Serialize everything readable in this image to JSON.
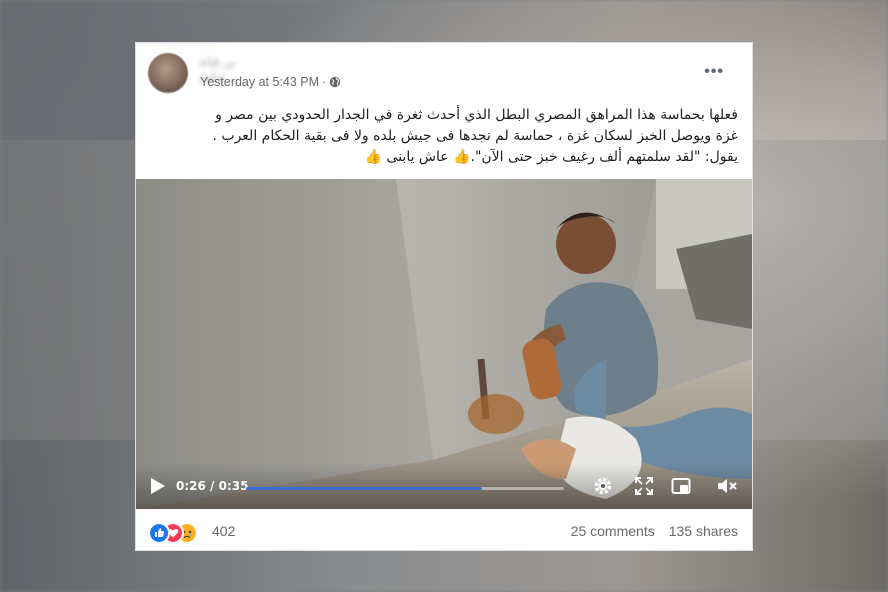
{
  "post": {
    "author": "بن فتاة سليم",
    "timestamp": "Yesterday at 5:43 PM",
    "separator": "·",
    "privacy_icon": "globe-icon",
    "more_icon": "more-horizontal-icon",
    "text_line1": "فعلها بحماسة هذا المراهق المصري البطل الذي أحدث ثغرة في الجدار الحدودي بين مصر و",
    "text_line2": "غزة ويوصل الخبز لسكان غزة ، حماسة لم نجدها فى جيش بلده ولا فى بقية الحكام العرب .",
    "text_line3": "يقول: \"لقد سلمتهم ألف رغيف خبز حتى الآن\".👍 عاش يابنى 👍"
  },
  "video": {
    "current_time": "0:26",
    "duration": "0:35",
    "time_sep": " / ",
    "progress": 0.743,
    "icons": [
      "play-icon",
      "settings-icon",
      "fullscreen-icon",
      "picture-in-picture-icon",
      "volume-muted-icon"
    ]
  },
  "footer": {
    "reaction_icons": [
      "like-icon",
      "love-icon",
      "sad-icon"
    ],
    "reaction_count": "402",
    "comments": "25 comments",
    "shares": "135 shares"
  },
  "colors": {
    "accent": "#3b6fd8",
    "like": "#1877f2",
    "love": "#f33e58",
    "sad": "#f7b125",
    "meta_text": "#65676b"
  }
}
